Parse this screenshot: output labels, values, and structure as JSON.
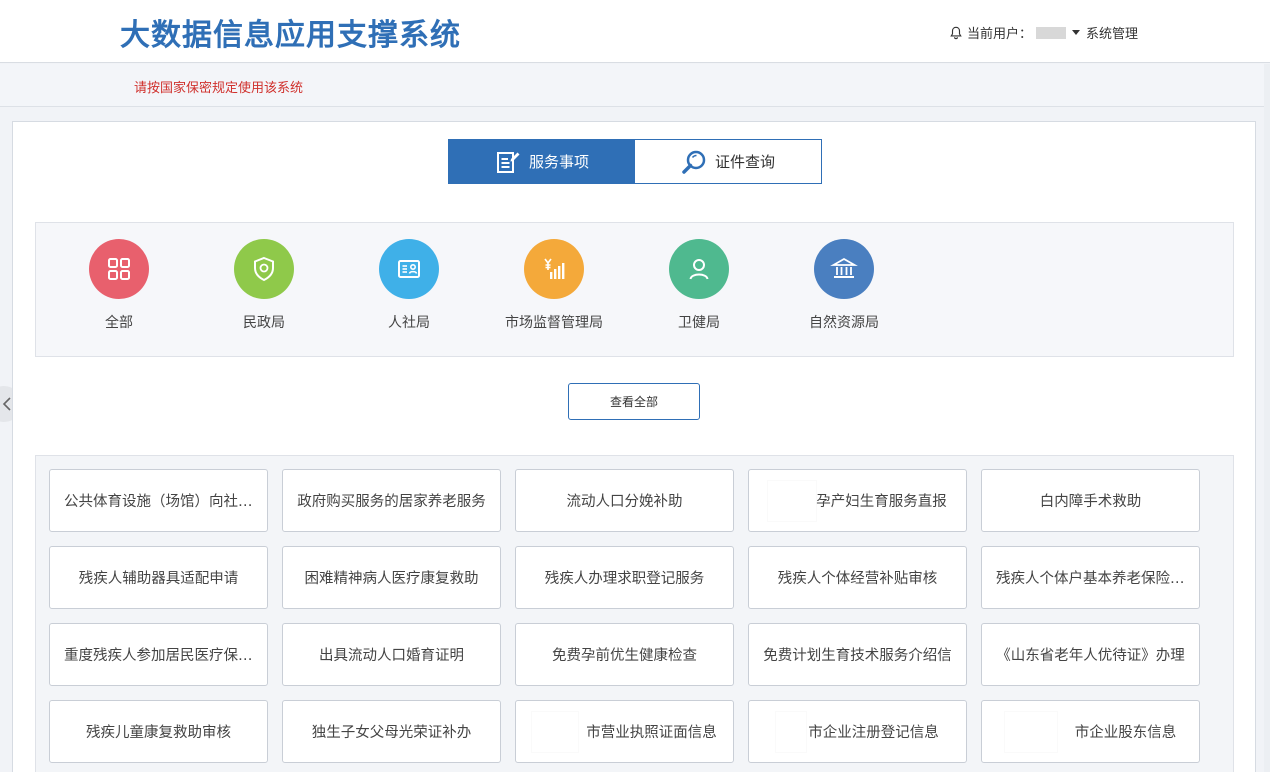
{
  "header": {
    "title": "大数据信息应用支撑系统",
    "user_prefix": "当前用户：",
    "user_role": "系统管理"
  },
  "notice": "请按国家保密规定使用该系统",
  "tabs": [
    {
      "label": "服务事项",
      "icon": "edit-document-icon",
      "active": true
    },
    {
      "label": "证件查询",
      "icon": "search-icon",
      "active": false
    }
  ],
  "departments": [
    {
      "label": "全部",
      "icon": "grid-icon",
      "color": "#e8606d"
    },
    {
      "label": "民政局",
      "icon": "shield-icon",
      "color": "#8fc94a"
    },
    {
      "label": "人社局",
      "icon": "id-card-icon",
      "color": "#3fb0e8"
    },
    {
      "label": "市场监督管理局",
      "icon": "yuan-chart-icon",
      "color": "#f4a93a"
    },
    {
      "label": "卫健局",
      "icon": "person-icon",
      "color": "#4fb98f"
    },
    {
      "label": "自然资源局",
      "icon": "bank-icon",
      "color": "#4a7fc0"
    }
  ],
  "view_all_label": "查看全部",
  "items": [
    "公共体育设施（场馆）向社会开放",
    "政府购买服务的居家养老服务",
    "流动人口分娩补助",
    "孕产妇生育服务直报",
    "白内障手术救助",
    "残疾人辅助器具适配申请",
    "困难精神病人医疗康复救助",
    "残疾人办理求职登记服务",
    "残疾人个体经营补贴审核",
    "残疾人个体户基本养老保险补贴",
    "重度残疾人参加居民医疗保险补贴",
    "出具流动人口婚育证明",
    "免费孕前优生健康检查",
    "免费计划生育技术服务介绍信",
    "《山东省老年人优待证》办理",
    "残疾儿童康复救助审核",
    "独生子女父母光荣证补办",
    "市营业执照证面信息",
    "市企业注册登记信息",
    "市企业股东信息"
  ],
  "colors": {
    "brand": "#2f6fb6",
    "notice": "#d0312d"
  }
}
